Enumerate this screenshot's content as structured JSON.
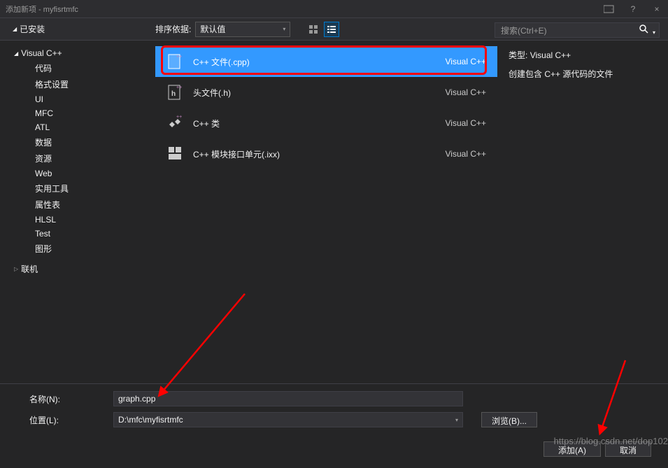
{
  "titlebar": {
    "title": "添加新项 - myfisrtmfc",
    "help_tooltip": "?",
    "close_tooltip": "×"
  },
  "toolbar": {
    "installed_label": "已安装",
    "sort_label": "排序依据:",
    "sort_value": "默认值",
    "search_placeholder": "搜索(Ctrl+E)"
  },
  "sidebar": {
    "root": "Visual C++",
    "children": [
      "代码",
      "格式设置",
      "UI",
      "MFC",
      "ATL",
      "数据",
      "资源",
      "Web",
      "实用工具",
      "属性表",
      "HLSL",
      "Test",
      "图形"
    ],
    "online": "联机"
  },
  "templates": [
    {
      "name": "C++ 文件(.cpp)",
      "lang": "Visual C++",
      "selected": true
    },
    {
      "name": "头文件(.h)",
      "lang": "Visual C++",
      "selected": false
    },
    {
      "name": "C++ 类",
      "lang": "Visual C++",
      "selected": false
    },
    {
      "name": "C++ 模块接口单元(.ixx)",
      "lang": "Visual C++",
      "selected": false
    }
  ],
  "right_panel": {
    "type_label": "类型:",
    "type_value": "Visual C++",
    "description": "创建包含 C++ 源代码的文件"
  },
  "form": {
    "name_label": "名称(N):",
    "name_value": "graph.cpp",
    "location_label": "位置(L):",
    "location_value": "D:\\mfc\\myfisrtmfc",
    "browse_label": "浏览(B)...",
    "add_label": "添加(A)",
    "cancel_label": "取消"
  },
  "watermark": "https://blog.csdn.net/dop102"
}
